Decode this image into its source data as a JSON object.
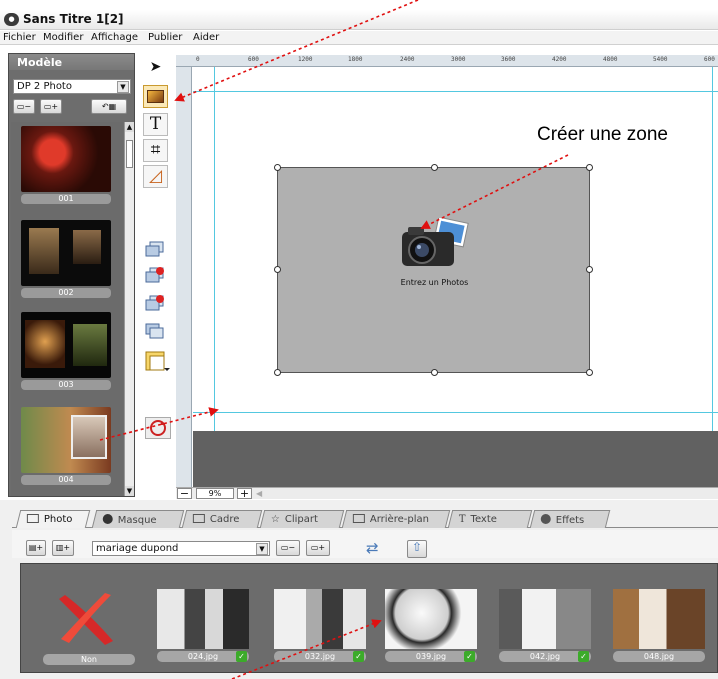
{
  "window": {
    "title": "Sans Titre 1[2]"
  },
  "menu": [
    "Fichier",
    "Modifier",
    "Affichage",
    "Publier",
    "Aider"
  ],
  "left_panel": {
    "header": "Modèle",
    "preset_select": "DP 2 Photo",
    "templates": [
      {
        "label": "001"
      },
      {
        "label": "002"
      },
      {
        "label": "003"
      },
      {
        "label": "004"
      }
    ]
  },
  "canvas": {
    "zone_label": "Entrez un Photos",
    "annotation": "Créer une zone",
    "ruler_labels": [
      "0",
      "600",
      "1200",
      "1800",
      "2400",
      "3000",
      "3600",
      "4200",
      "4800",
      "5400",
      "600"
    ]
  },
  "zoom": {
    "value": "9%",
    "minus": "−",
    "plus": "+"
  },
  "bottom_tabs": [
    "Photo",
    "Masque",
    "Cadre",
    "Clipart",
    "Arrière-plan",
    "Texte",
    "Effets"
  ],
  "album_select": "mariage dupond",
  "photos": [
    {
      "label": "Non"
    },
    {
      "label": "024.jpg"
    },
    {
      "label": "032.jpg"
    },
    {
      "label": "039.jpg"
    },
    {
      "label": "042.jpg"
    },
    {
      "label": "048.jpg"
    }
  ],
  "icons": {
    "app": "app-logo-icon",
    "arrow_tool": "select-arrow-icon",
    "photo_tool": "photo-frame-icon",
    "text_tool": "text-T-icon",
    "crop_tool": "crop-icon",
    "shape_tool": "triangle-ruler-icon"
  },
  "colors": {
    "guide": "#53c8e0",
    "annotation_arrow": "#e01010",
    "check": "#3cab2a",
    "zone": "#b0b0b0"
  }
}
